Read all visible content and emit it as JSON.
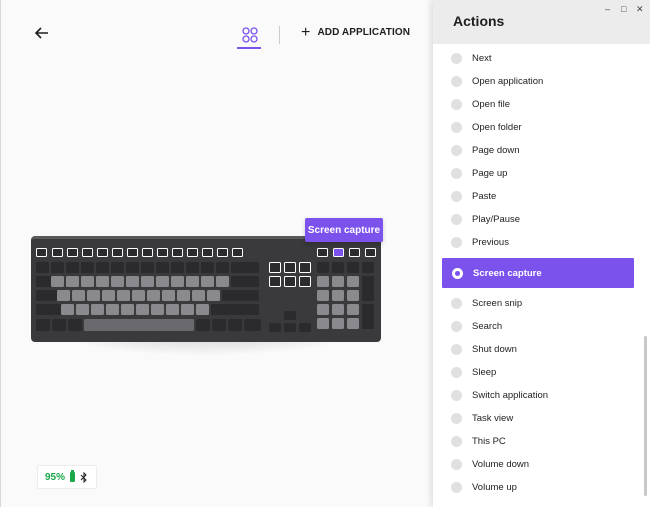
{
  "toolbar": {
    "add_application_label": "ADD APPLICATION"
  },
  "tooltip": {
    "label": "Screen capture"
  },
  "battery": {
    "percent_label": "95%",
    "color": "#1aa84a"
  },
  "panel": {
    "title": "Actions",
    "window_controls": [
      "–",
      "□",
      "✕"
    ],
    "items": [
      {
        "label": "Next"
      },
      {
        "label": "Open application"
      },
      {
        "label": "Open file"
      },
      {
        "label": "Open folder"
      },
      {
        "label": "Page down"
      },
      {
        "label": "Page up"
      },
      {
        "label": "Paste"
      },
      {
        "label": "Play/Pause"
      },
      {
        "label": "Previous"
      },
      {
        "label": "Screen capture",
        "selected": true
      },
      {
        "label": "Screen snip"
      },
      {
        "label": "Search"
      },
      {
        "label": "Shut down"
      },
      {
        "label": "Sleep"
      },
      {
        "label": "Switch application"
      },
      {
        "label": "Task view"
      },
      {
        "label": "This PC"
      },
      {
        "label": "Volume down"
      },
      {
        "label": "Volume up"
      }
    ]
  },
  "colors": {
    "accent": "#7b52ec",
    "panel_header": "#ececec"
  },
  "icons": [
    "back-arrow-icon",
    "device-grid-icon",
    "plus-icon",
    "battery-icon",
    "bluetooth-icon",
    "radio-icon"
  ]
}
